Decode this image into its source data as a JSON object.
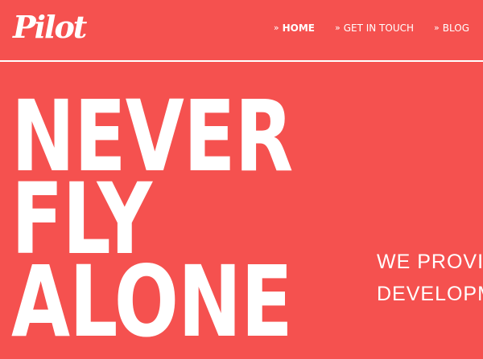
{
  "brand": {
    "logo_text": "Pilot"
  },
  "nav": {
    "items": [
      {
        "label": "HOME",
        "marker": "»",
        "active": true
      },
      {
        "label": "GET IN TOUCH",
        "marker": "»",
        "active": false
      },
      {
        "label": "BLOG",
        "marker": "»",
        "active": false
      }
    ]
  },
  "hero": {
    "lines": [
      "NEVER",
      "FLY",
      "ALONE"
    ]
  },
  "tagline": {
    "lines": [
      "WE PROVID",
      "DEVELOPM"
    ]
  },
  "colors": {
    "background": "#f5514f",
    "foreground": "#ffffff"
  }
}
